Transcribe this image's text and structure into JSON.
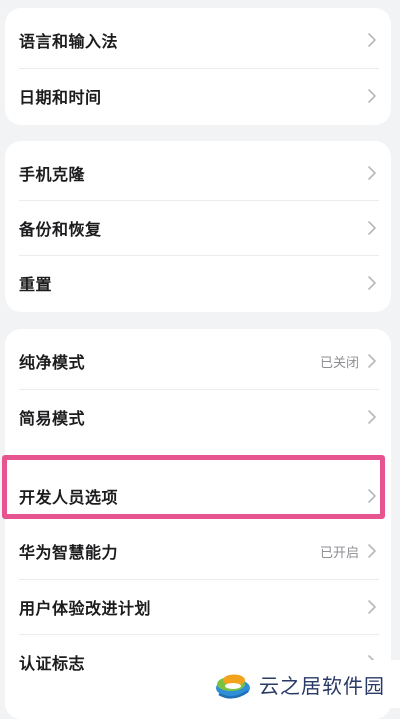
{
  "groups": [
    {
      "items": [
        {
          "label": "语言和输入法",
          "value": ""
        },
        {
          "label": "日期和时间",
          "value": ""
        }
      ]
    },
    {
      "items": [
        {
          "label": "手机克隆",
          "value": ""
        },
        {
          "label": "备份和恢复",
          "value": ""
        },
        {
          "label": "重置",
          "value": ""
        }
      ]
    },
    {
      "items": [
        {
          "label": "纯净模式",
          "value": "已关闭"
        },
        {
          "label": "简易模式",
          "value": ""
        },
        {
          "label": "开发人员选项",
          "value": ""
        },
        {
          "label": "华为智慧能力",
          "value": "已开启"
        },
        {
          "label": "用户体验改进计划",
          "value": ""
        },
        {
          "label": "认证标志",
          "value": ""
        }
      ]
    }
  ],
  "highlight_color": "#e6558f",
  "watermark": {
    "text": "云之居软件园",
    "icon": "site-logo-icon"
  },
  "icons": {
    "chevron": "chevron-right-icon"
  }
}
